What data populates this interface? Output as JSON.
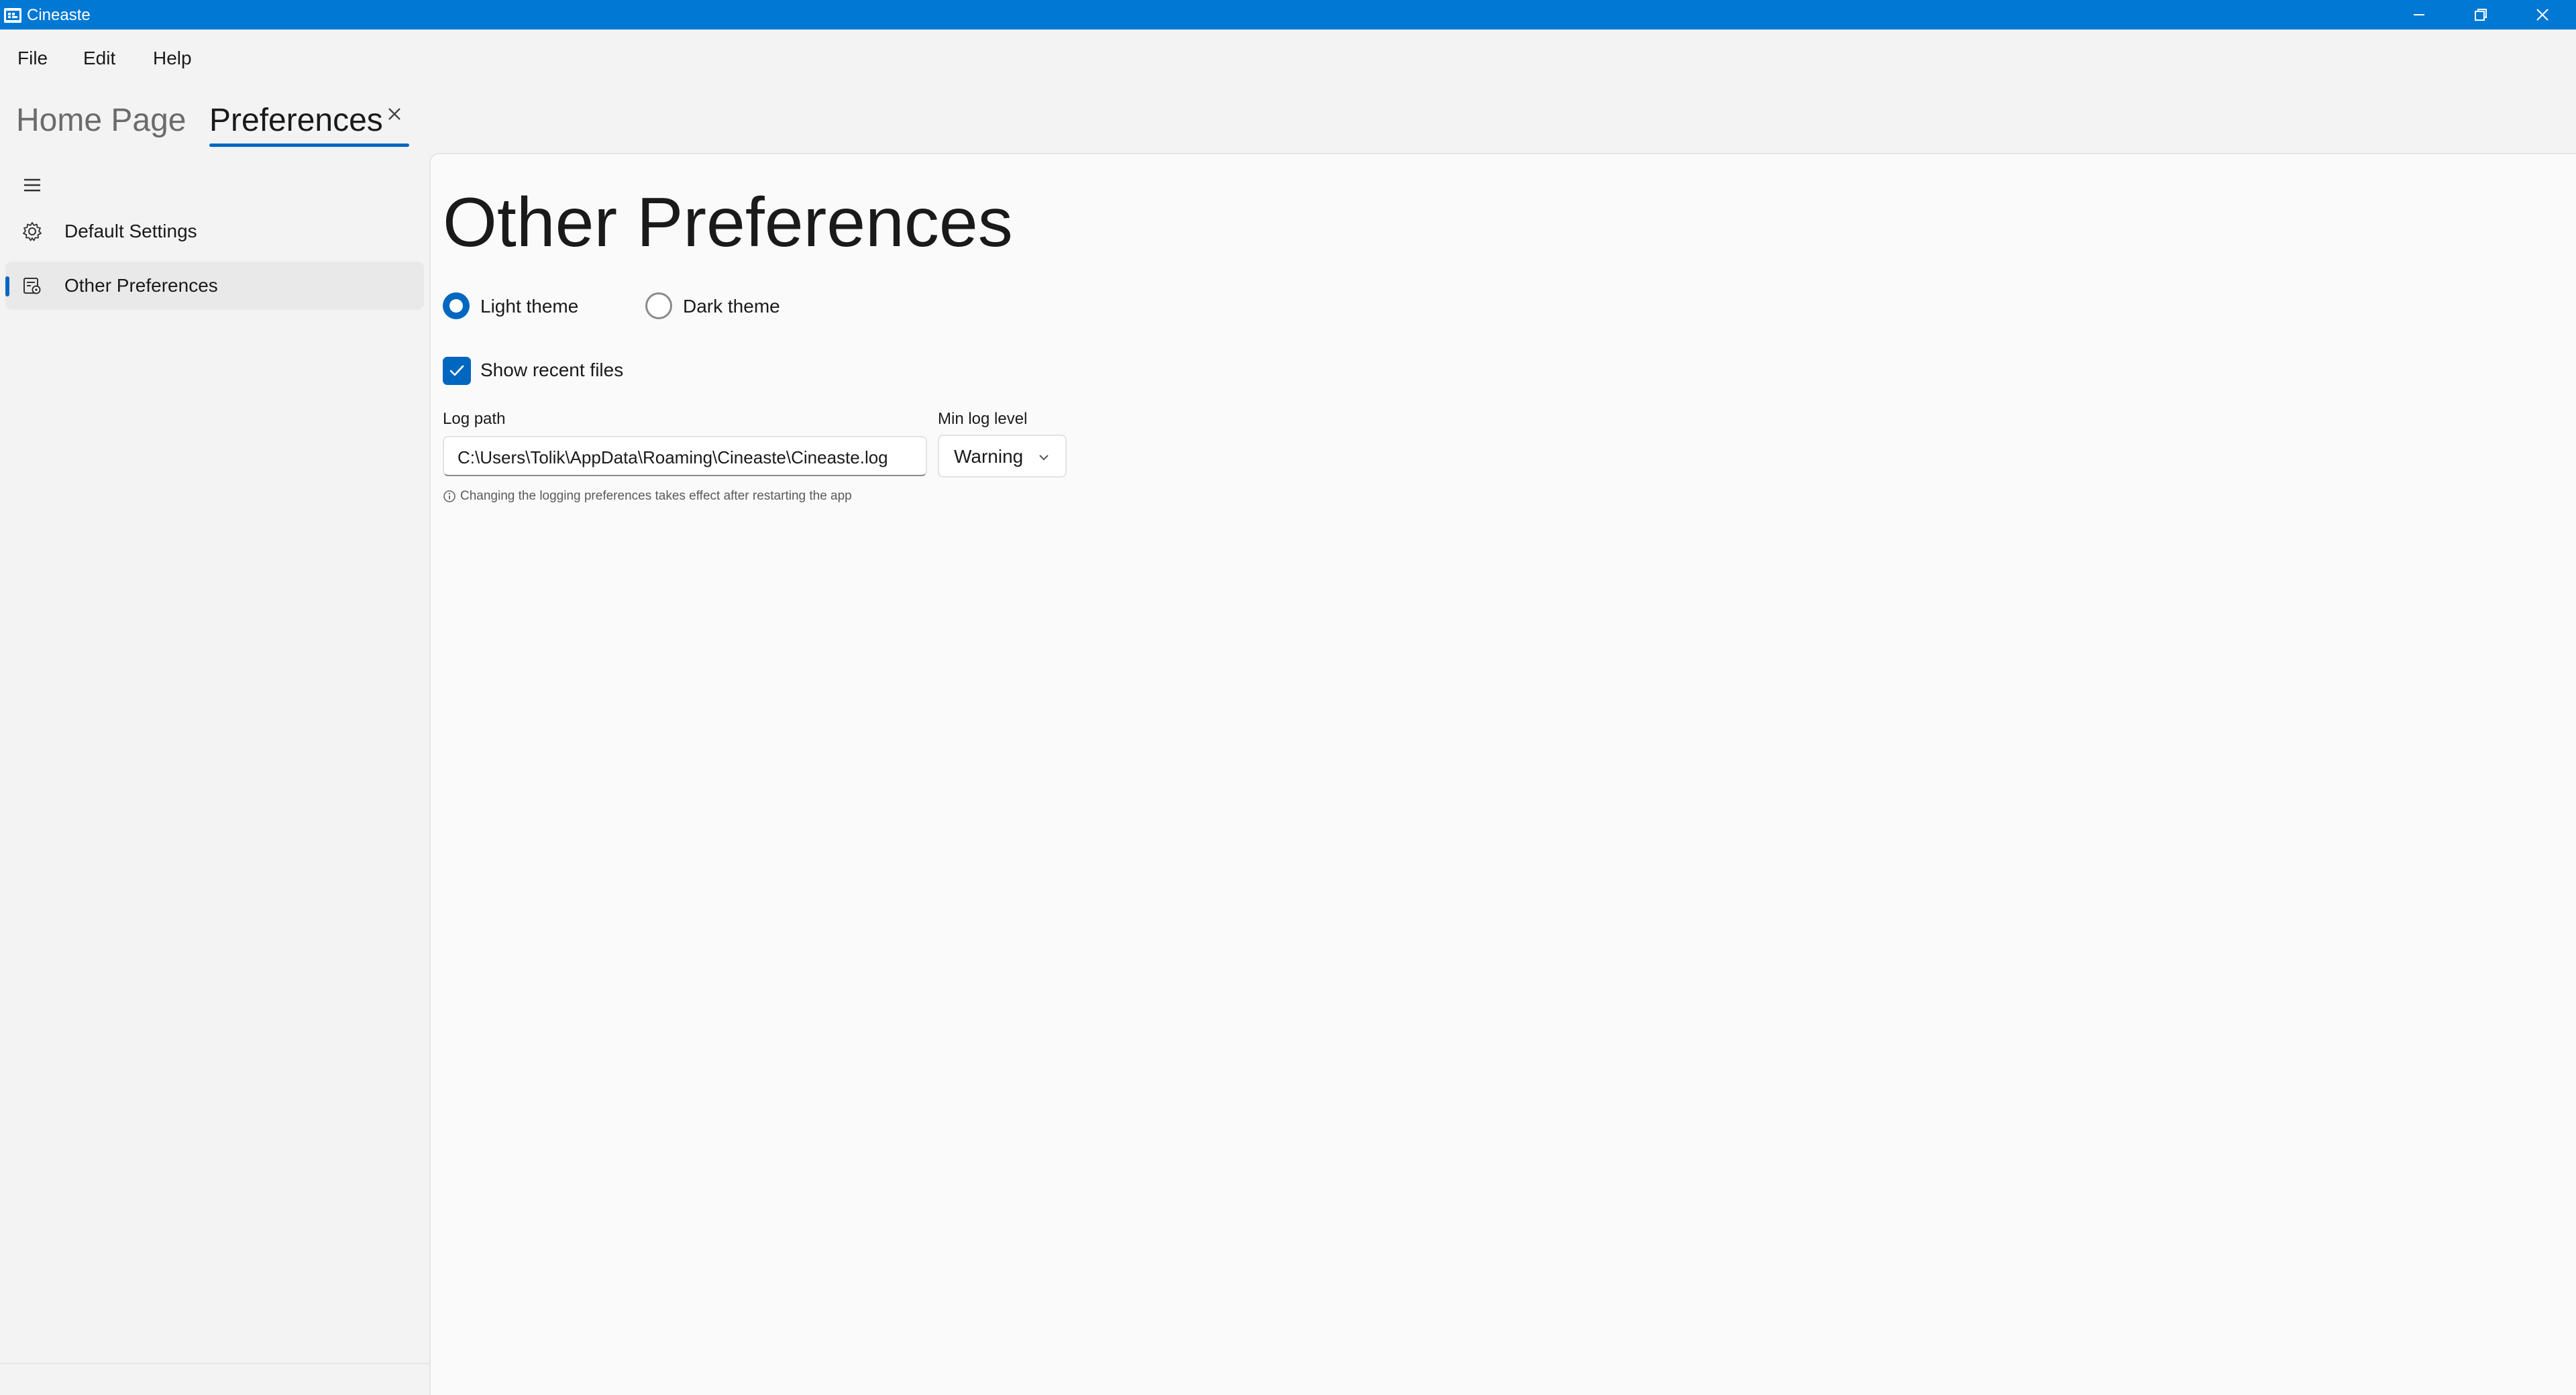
{
  "window": {
    "title": "Cineaste",
    "icons": {
      "app": "film-app-icon",
      "minimize": "minimize-icon",
      "restore": "restore-icon",
      "close": "close-icon"
    },
    "colors": {
      "titlebar": "#0078d4",
      "accent": "#0067c0"
    }
  },
  "menu": {
    "file": "File",
    "edit": "Edit",
    "help": "Help"
  },
  "tabs": [
    {
      "label": "Home Page",
      "selected": false
    },
    {
      "label": "Preferences",
      "selected": true,
      "closable": true
    }
  ],
  "nav": {
    "menu_icon": "hamburger-icon",
    "items": [
      {
        "label": "Default Settings",
        "icon": "gear-icon",
        "selected": false
      },
      {
        "label": "Other Preferences",
        "icon": "preferences-icon",
        "selected": true
      }
    ]
  },
  "main": {
    "title": "Other Preferences",
    "theme": {
      "options": [
        {
          "label": "Light theme",
          "selected": true
        },
        {
          "label": "Dark theme",
          "selected": false
        }
      ]
    },
    "show_recent_files": {
      "label": "Show recent files",
      "checked": true
    },
    "log_path": {
      "label": "Log path",
      "value": "C:\\Users\\Tolik\\AppData\\Roaming\\Cineaste\\Cineaste.log"
    },
    "min_log_level": {
      "label": "Min log level",
      "value": "Warning"
    },
    "hint": {
      "icon": "info-icon",
      "text": "Changing the logging preferences takes effect after restarting the app"
    }
  }
}
